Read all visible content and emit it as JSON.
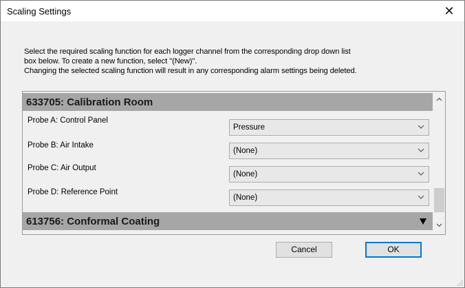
{
  "window": {
    "title": "Scaling Settings",
    "close_symbol": "✕"
  },
  "instructions": {
    "line1": "Select the required scaling function for each logger channel from the corresponding drop down list",
    "line2": "box below. To create a new function, select \"(New)\".",
    "line3": "Changing the selected scaling function will result in any corresponding alarm settings being deleted."
  },
  "groups": [
    {
      "title": "633705: Calibration Room",
      "probes": [
        {
          "label": "Probe A: Control Panel",
          "function": "Pressure"
        },
        {
          "label": "Probe B: Air Intake",
          "function": "(None)"
        },
        {
          "label": "Probe C: Air Output",
          "function": "(None)"
        },
        {
          "label": "Probe D: Reference Point",
          "function": "(None)"
        }
      ]
    },
    {
      "title": "613756: Conformal Coating"
    }
  ],
  "buttons": {
    "cancel": "Cancel",
    "ok": "OK"
  },
  "icons": {
    "close": "close-icon",
    "dropdown": "chevron-down-icon",
    "collapse": "triangle-down-icon",
    "scroll_up": "scroll-up-arrow-icon",
    "scroll_down": "scroll-down-arrow-icon",
    "resize": "resize-grip-icon"
  },
  "colors": {
    "group_header": "#a6a6a6",
    "default_button_border": "#0078d7"
  }
}
